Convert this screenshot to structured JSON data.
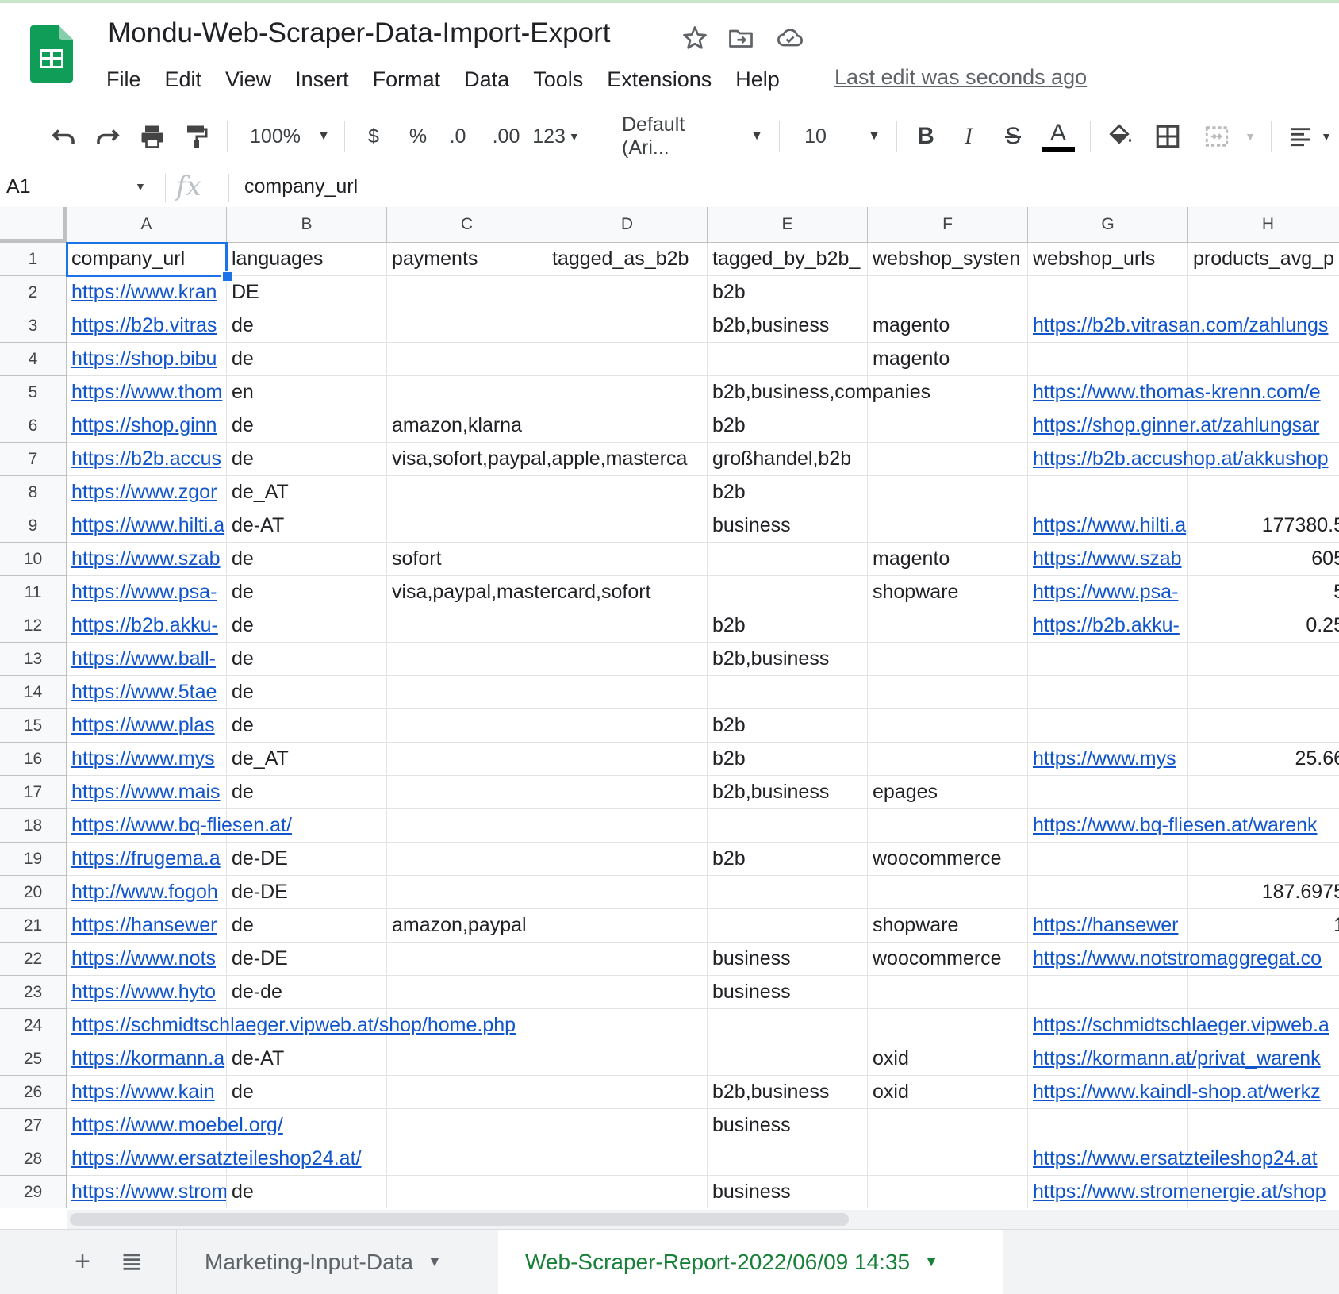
{
  "doc": {
    "title": "Mondu-Web-Scraper-Data-Import-Export",
    "last_edit": "Last edit was seconds ago",
    "menu": [
      "File",
      "Edit",
      "View",
      "Insert",
      "Format",
      "Data",
      "Tools",
      "Extensions",
      "Help"
    ]
  },
  "toolbar": {
    "zoom": "100%",
    "currency": "$",
    "percent": "%",
    "dec_decrease": ".0",
    "dec_increase": ".00",
    "format_more": "123",
    "font": "Default (Ari...",
    "font_size": "10",
    "bold": "B",
    "italic": "I",
    "strike": "S",
    "text_color_glyph": "A"
  },
  "formula_bar": {
    "name_box": "A1",
    "fx": "fx",
    "value": "company_url"
  },
  "sheet": {
    "columns": [
      "A",
      "B",
      "C",
      "D",
      "E",
      "F",
      "G",
      "H"
    ],
    "rows": [
      {
        "num": "1",
        "cells": [
          "company_url",
          "languages",
          "payments",
          "tagged_as_b2b",
          "tagged_by_b2b_",
          "webshop_systen",
          "webshop_urls",
          "products_avg_p"
        ]
      },
      {
        "num": "2",
        "cells": [
          "https://www.kran",
          "DE",
          "",
          "",
          "b2b",
          "",
          "",
          ""
        ]
      },
      {
        "num": "3",
        "cells": [
          "https://b2b.vitras",
          "de",
          "",
          "",
          "b2b,business",
          "magento",
          "https://b2b.vitrasan.com/zahlungs",
          ""
        ]
      },
      {
        "num": "4",
        "cells": [
          "https://shop.bibu",
          "de",
          "",
          "",
          "",
          "magento",
          "",
          ""
        ]
      },
      {
        "num": "5",
        "cells": [
          "https://www.thom",
          "en",
          "",
          "",
          "b2b,business,companies",
          "",
          "https://www.thomas-krenn.com/e",
          ""
        ]
      },
      {
        "num": "6",
        "cells": [
          "https://shop.ginn",
          "de",
          "amazon,klarna",
          "",
          "b2b",
          "",
          "https://shop.ginner.at/zahlungsar",
          ""
        ]
      },
      {
        "num": "7",
        "cells": [
          "https://b2b.accus",
          "de",
          "visa,sofort,paypal,apple,masterca",
          "",
          "großhandel,b2b",
          "",
          "https://b2b.accushop.at/akkushop",
          ""
        ]
      },
      {
        "num": "8",
        "cells": [
          "https://www.zgor",
          "de_AT",
          "",
          "",
          "b2b",
          "",
          "",
          ""
        ]
      },
      {
        "num": "9",
        "cells": [
          "https://www.hilti.a",
          "de-AT",
          "",
          "",
          "business",
          "",
          "https://www.hilti.a",
          "177380.5"
        ]
      },
      {
        "num": "10",
        "cells": [
          "https://www.szab",
          "de",
          "sofort",
          "",
          "",
          "magento",
          "https://www.szab",
          "605"
        ]
      },
      {
        "num": "11",
        "cells": [
          "https://www.psa-",
          "de",
          "visa,paypal,mastercard,sofort",
          "",
          "",
          "shopware",
          "https://www.psa-",
          "5"
        ]
      },
      {
        "num": "12",
        "cells": [
          "https://b2b.akku-",
          "de",
          "",
          "",
          "b2b",
          "",
          "https://b2b.akku-",
          "0.25"
        ]
      },
      {
        "num": "13",
        "cells": [
          "https://www.ball-",
          "de",
          "",
          "",
          "b2b,business",
          "",
          "",
          ""
        ]
      },
      {
        "num": "14",
        "cells": [
          "https://www.5tae",
          "de",
          "",
          "",
          "",
          "",
          "",
          ""
        ]
      },
      {
        "num": "15",
        "cells": [
          "https://www.plas",
          "de",
          "",
          "",
          "b2b",
          "",
          "",
          ""
        ]
      },
      {
        "num": "16",
        "cells": [
          "https://www.mys",
          "de_AT",
          "",
          "",
          "b2b",
          "",
          "https://www.mys",
          "25.66"
        ]
      },
      {
        "num": "17",
        "cells": [
          "https://www.mais",
          "de",
          "",
          "",
          "b2b,business",
          "epages",
          "",
          ""
        ]
      },
      {
        "num": "18",
        "cells": [
          "https://www.bq-fliesen.at/",
          "",
          "",
          "",
          "",
          "",
          "https://www.bq-fliesen.at/warenk",
          ""
        ]
      },
      {
        "num": "19",
        "cells": [
          "https://frugema.a",
          "de-DE",
          "",
          "",
          "b2b",
          "woocommerce",
          "",
          ""
        ]
      },
      {
        "num": "20",
        "cells": [
          "http://www.fogoh",
          "de-DE",
          "",
          "",
          "",
          "",
          "",
          "187.6975"
        ]
      },
      {
        "num": "21",
        "cells": [
          "https://hansewer",
          "de",
          "amazon,paypal",
          "",
          "",
          "shopware",
          "https://hansewer",
          "1"
        ]
      },
      {
        "num": "22",
        "cells": [
          "https://www.nots",
          "de-DE",
          "",
          "",
          "business",
          "woocommerce",
          "https://www.notstromaggregat.co",
          ""
        ]
      },
      {
        "num": "23",
        "cells": [
          "https://www.hyto",
          "de-de",
          "",
          "",
          "business",
          "",
          "",
          ""
        ]
      },
      {
        "num": "24",
        "cells": [
          "https://schmidtschlaeger.vipweb.at/shop/home.php",
          "",
          "",
          "",
          "",
          "",
          "https://schmidtschlaeger.vipweb.a",
          ""
        ]
      },
      {
        "num": "25",
        "cells": [
          "https://kormann.a",
          "de-AT",
          "",
          "",
          "",
          "oxid",
          "https://kormann.at/privat_warenk",
          ""
        ]
      },
      {
        "num": "26",
        "cells": [
          "https://www.kain",
          "de",
          "",
          "",
          "b2b,business",
          "oxid",
          "https://www.kaindl-shop.at/werkz",
          ""
        ]
      },
      {
        "num": "27",
        "cells": [
          "https://www.moebel.org/",
          "",
          "",
          "",
          "business",
          "",
          "",
          ""
        ]
      },
      {
        "num": "28",
        "cells": [
          "https://www.ersatzteileshop24.at/",
          "",
          "",
          "",
          "",
          "",
          "https://www.ersatzteileshop24.at",
          ""
        ]
      },
      {
        "num": "29",
        "cells": [
          "https://www.strom",
          "de",
          "",
          "",
          "business",
          "",
          "https://www.stromenergie.at/shop",
          ""
        ]
      }
    ]
  },
  "sheets": {
    "add_icon": "+",
    "tabs": [
      {
        "label": "Marketing-Input-Data",
        "active": false
      },
      {
        "label": "Web-Scraper-Report-2022/06/09 14:35",
        "active": true
      }
    ]
  },
  "colors": {
    "accent_green": "#188038",
    "logo_green": "#0f9d58",
    "link_blue": "#1155cc",
    "selection_blue": "#1a73e8"
  }
}
